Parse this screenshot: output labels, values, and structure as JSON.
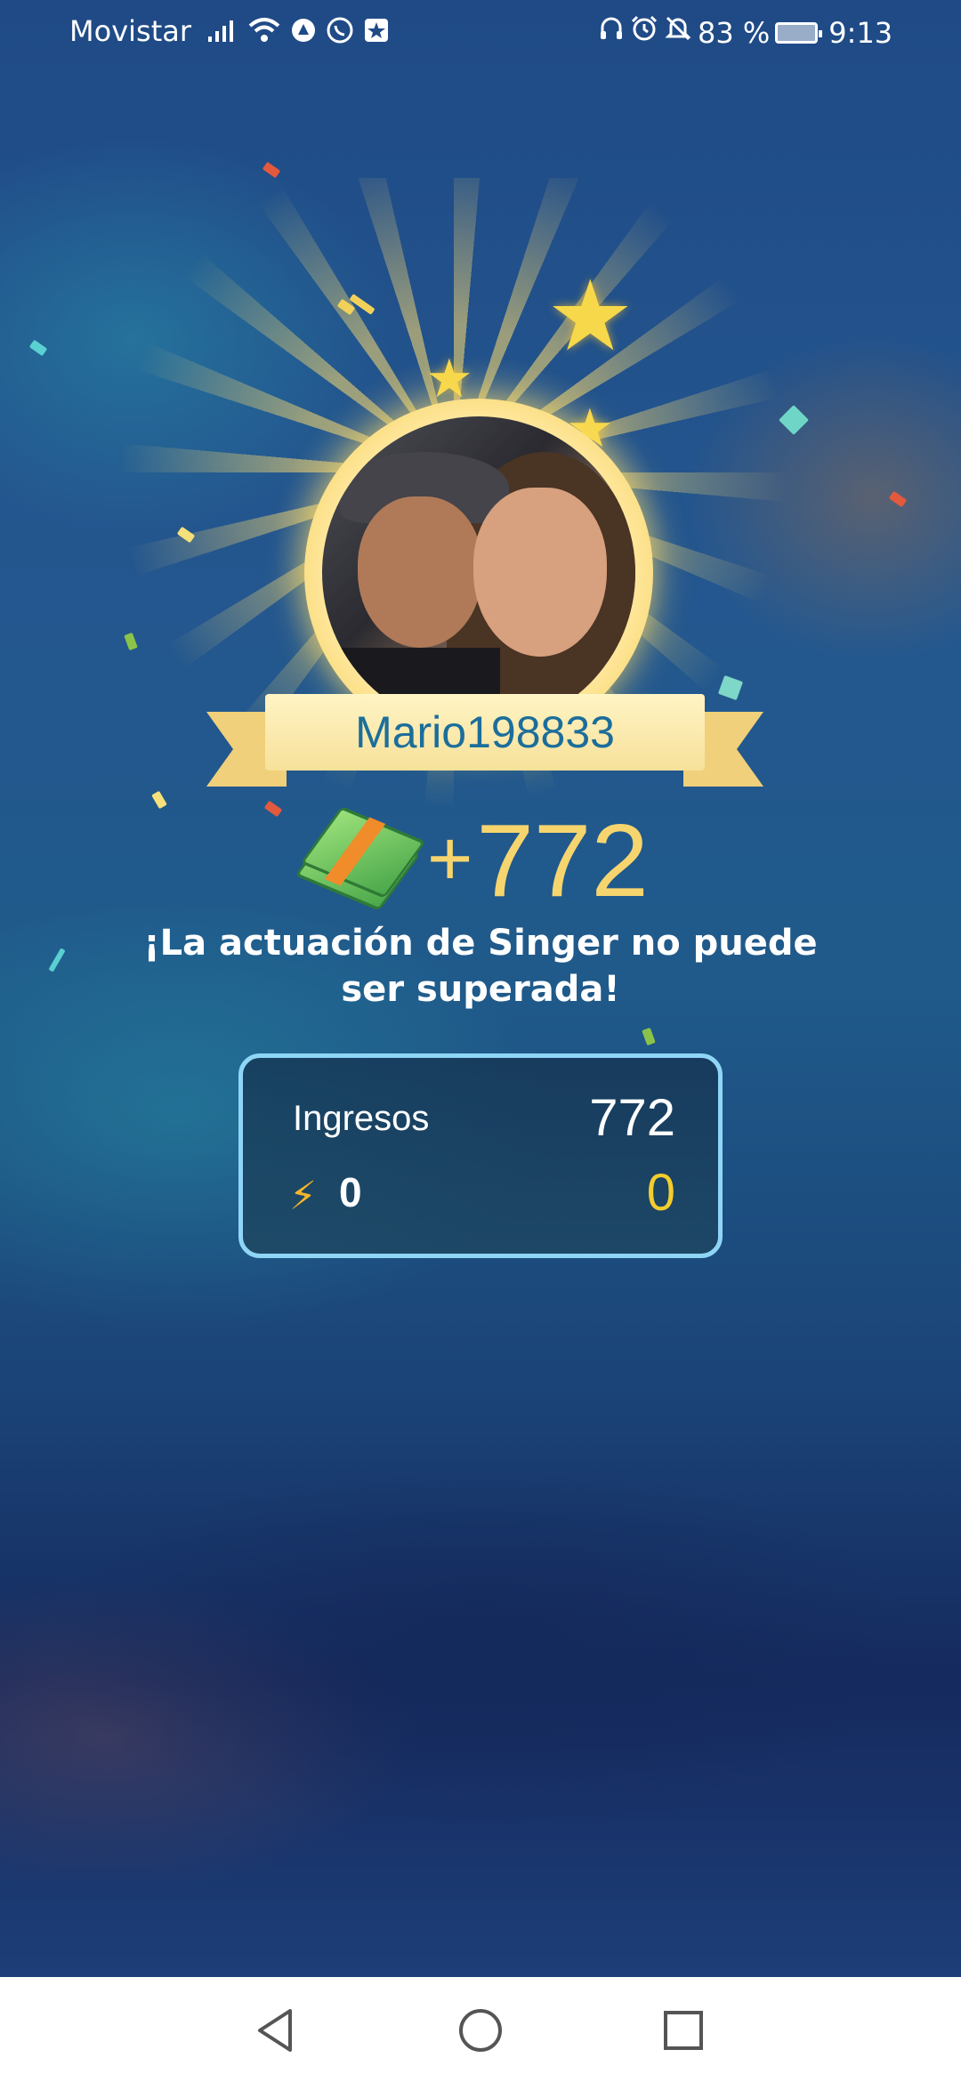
{
  "status_bar": {
    "carrier": "Movistar",
    "battery_percent": "83 %",
    "time": "9:13",
    "left_icons": [
      "signal-icon",
      "wifi-icon",
      "app-icon",
      "whatsapp-icon",
      "star-app-icon"
    ],
    "right_icons": [
      "headphones-icon",
      "alarm-icon",
      "mute-icon",
      "battery-icon"
    ]
  },
  "result": {
    "username": "Mario198833",
    "reward_prefix": "+",
    "reward_amount": "772",
    "message": "¡La actuación de Singer no puede ser superada!"
  },
  "earnings_card": {
    "income_label": "Ingresos",
    "income_value": "772",
    "bonus_label": "0",
    "bonus_value": "0"
  },
  "colors": {
    "reward_gold": "#f6d56e",
    "username_blue": "#1c6e9a",
    "card_border": "#8fd6f6",
    "bonus_yellow": "#f3cd2c"
  },
  "nav_bar": [
    "back-icon",
    "home-icon",
    "recents-icon"
  ]
}
